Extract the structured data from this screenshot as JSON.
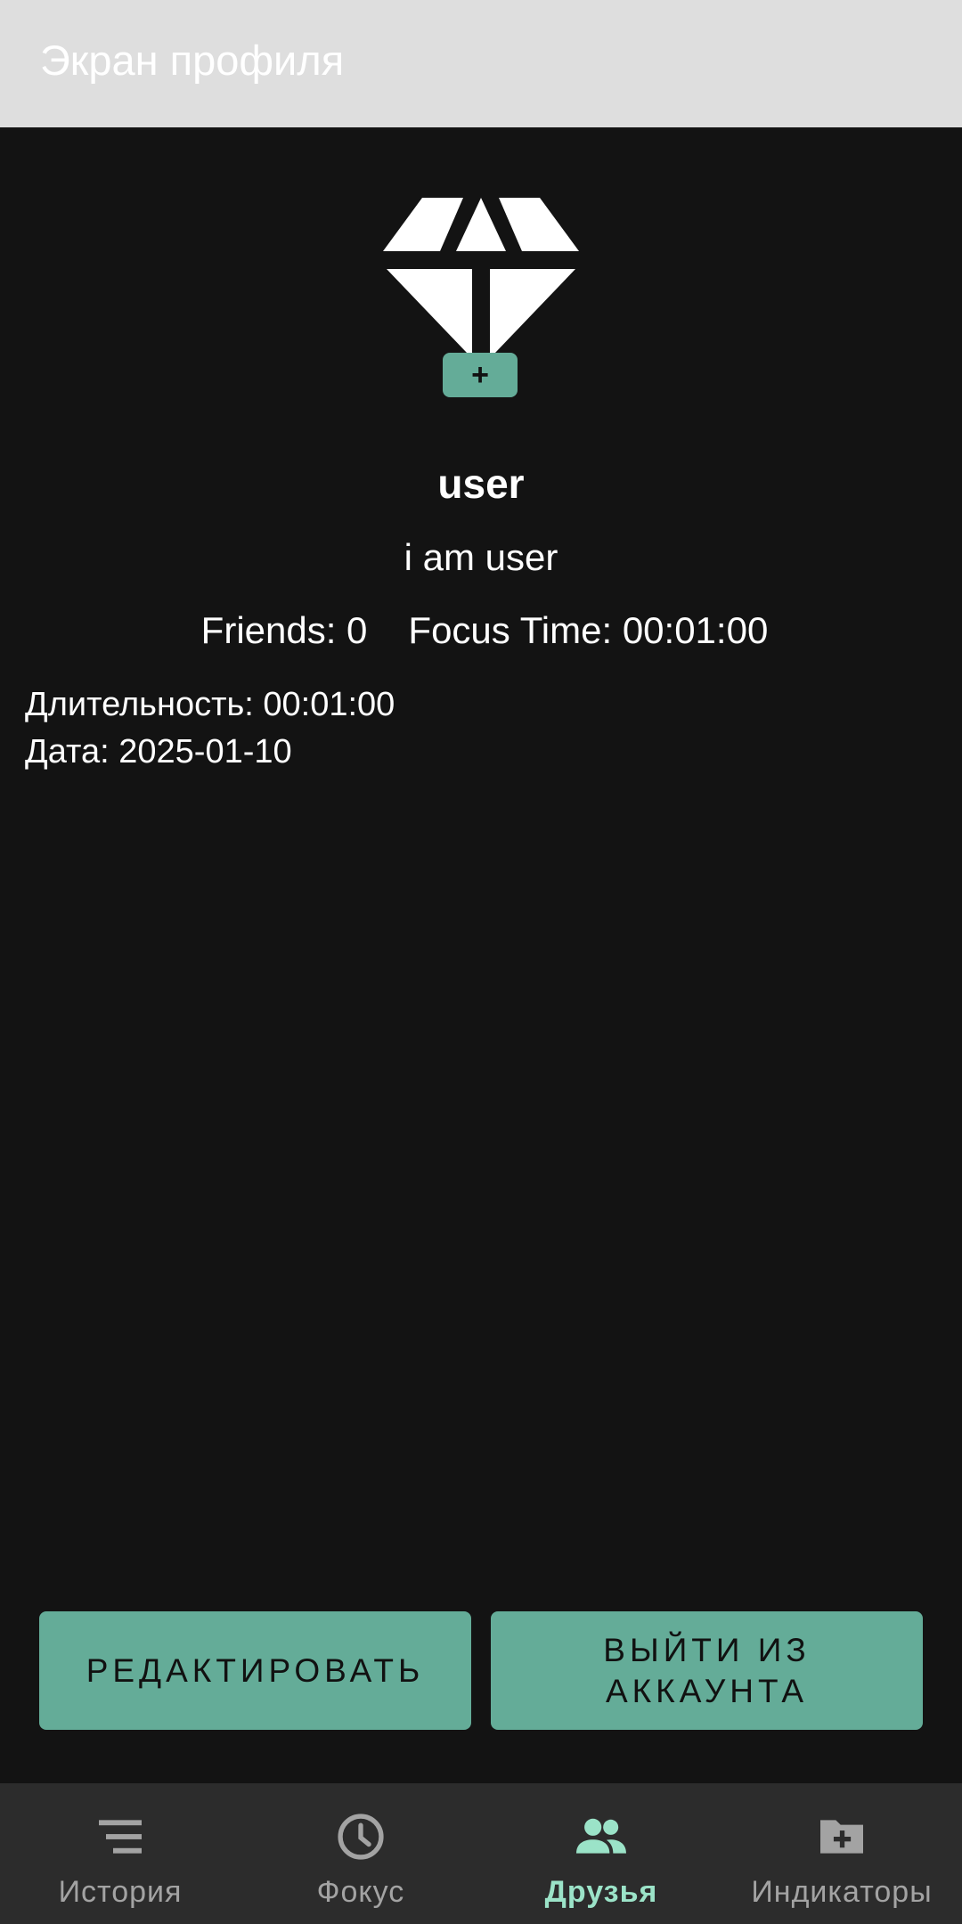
{
  "app_bar": {
    "title": "Экран профиля"
  },
  "profile": {
    "avatar_add_label": "+",
    "username": "user",
    "status": "i am user",
    "friends_text": "Friends: 0",
    "focus_time_text": "Focus Time: 00:01:00"
  },
  "session": {
    "duration_text": "Длительность: 00:01:00",
    "date_text": "Дата: 2025-01-10"
  },
  "actions": {
    "edit_label": "РЕДАКТИРОВАТЬ",
    "logout_label": "ВЫЙТИ ИЗ АККАУНТА"
  },
  "bottom_nav": {
    "items": [
      {
        "label": "История",
        "icon": "list-icon",
        "active": false
      },
      {
        "label": "Фокус",
        "icon": "clock-icon",
        "active": false
      },
      {
        "label": "Друзья",
        "icon": "people-icon",
        "active": true
      },
      {
        "label": "Индикаторы",
        "icon": "folder-add-icon",
        "active": false
      }
    ]
  },
  "colors": {
    "background": "#131313",
    "accent": "#64ac98",
    "active_nav": "#9be3c8",
    "inactive_nav": "#a3a3a3",
    "app_bar": "#dedede",
    "nav_bar": "#2c2c2c"
  }
}
